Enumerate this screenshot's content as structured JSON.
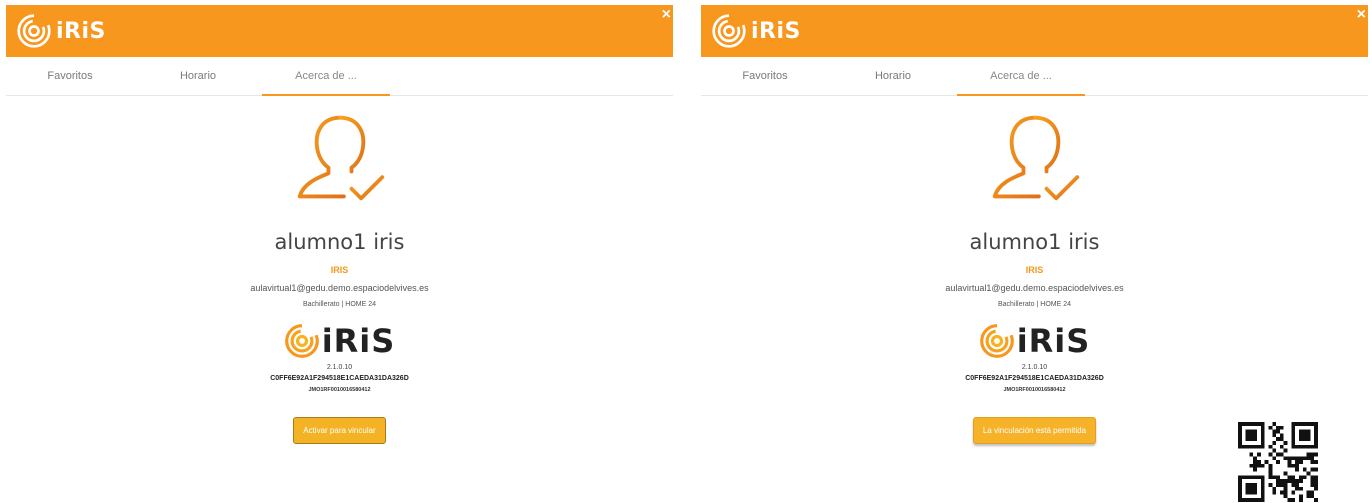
{
  "colors": {
    "brand": "#f7971e",
    "button": "#f3b324",
    "header_text": "#ffffff"
  },
  "panels": [
    {
      "app_name": "iRiS",
      "close_icon": "×",
      "tabs": [
        "Favoritos",
        "Horario",
        "Acerca de ..."
      ],
      "active_tab": 2,
      "user": {
        "name": "alumno1 iris",
        "org": "IRIS",
        "email": "aulavirtual1@gedu.demo.espaciodelvives.es",
        "course": "Bachillerato | HOME 24"
      },
      "brand": "iRiS",
      "version": "2.1.0.10",
      "hash": "C0FF6E92A1F294518E1CAEDA31DA326D",
      "device_id": "JMO1RF0010016580412",
      "action_label": "Activar para vincular"
    },
    {
      "app_name": "iRiS",
      "close_icon": "×",
      "tabs": [
        "Favoritos",
        "Horario",
        "Acerca de ..."
      ],
      "active_tab": 2,
      "user": {
        "name": "alumno1 iris",
        "org": "IRIS",
        "email": "aulavirtual1@gedu.demo.espaciodelvives.es",
        "course": "Bachillerato | HOME 24"
      },
      "brand": "iRiS",
      "version": "2.1.0.10",
      "hash": "C0FF6E92A1F294518E1CAEDA31DA326D",
      "device_id": "JMO1RF0010016580412",
      "action_label": "La vinculación está permitida"
    }
  ],
  "icons": {
    "logo": "iris-logo-icon",
    "avatar": "user-check-icon",
    "qr": "qr-code"
  }
}
